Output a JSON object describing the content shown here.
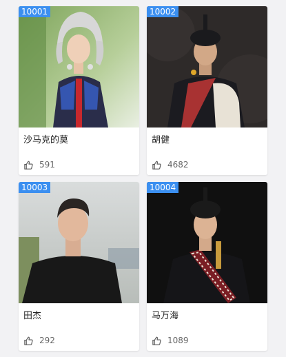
{
  "cards": [
    {
      "id": "10001",
      "name": "沙马克的莫",
      "likes": "591"
    },
    {
      "id": "10002",
      "name": "胡健",
      "likes": "4682"
    },
    {
      "id": "10003",
      "name": "田杰",
      "likes": "292"
    },
    {
      "id": "10004",
      "name": "马万海",
      "likes": "1089"
    }
  ],
  "icons": {
    "like": "thumbs-up-icon"
  },
  "colors": {
    "badge": "#3b8ff0",
    "background": "#f2f2f4"
  }
}
